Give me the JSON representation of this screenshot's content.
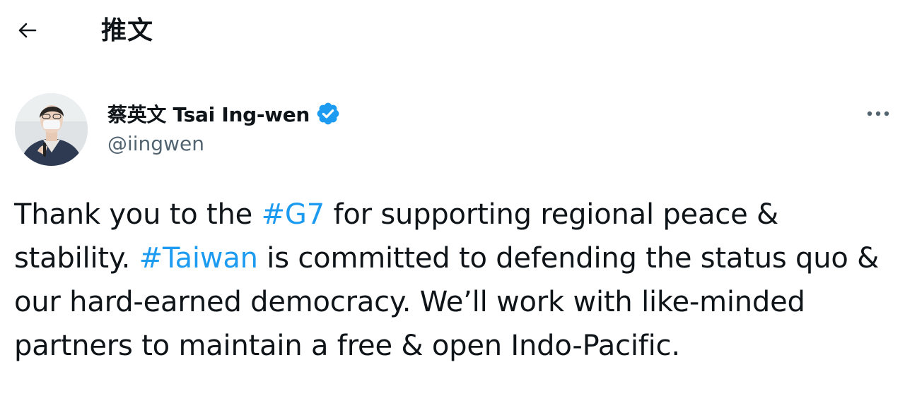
{
  "header": {
    "back_icon": "arrow-left-icon",
    "title": "推文"
  },
  "author": {
    "display_name": "蔡英文 Tsai Ing-wen",
    "handle": "@iingwen",
    "verified_icon": "verified-badge-icon",
    "avatar_icon": "avatar"
  },
  "more_icon": "more-horizontal-icon",
  "tweet": {
    "segments": [
      {
        "type": "text",
        "value": "Thank you to the "
      },
      {
        "type": "hashtag",
        "value": "#G7"
      },
      {
        "type": "text",
        "value": " for supporting regional peace & stability. "
      },
      {
        "type": "hashtag",
        "value": "#Taiwan"
      },
      {
        "type": "text",
        "value": " is committed to defending the status quo & our hard-earned democracy. We’ll work with like-minded partners to maintain a free & open Indo-Pacific."
      }
    ]
  },
  "colors": {
    "text": "#0f1419",
    "secondary": "#536471",
    "accent": "#1d9bf0"
  }
}
